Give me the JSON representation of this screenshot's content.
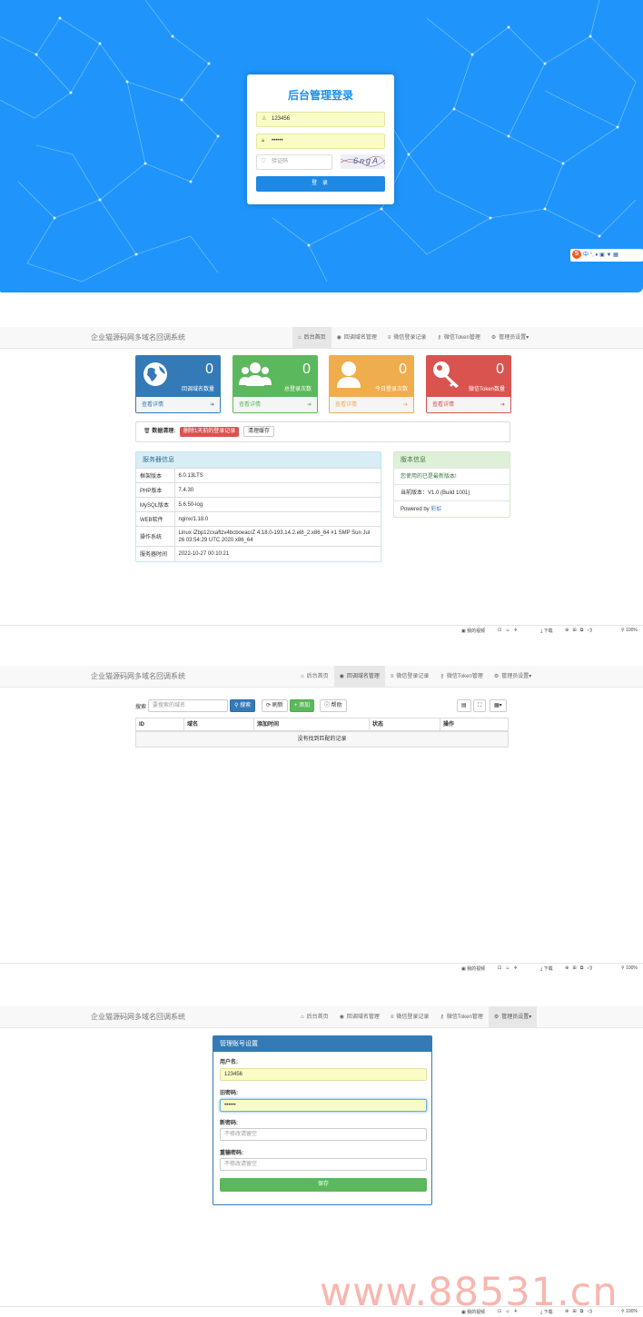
{
  "login": {
    "title": "后台管理登录",
    "username": "123456",
    "password": "••••••",
    "captcha_placeholder": "验证码",
    "captcha_text": "6ngA",
    "submit": "登 录",
    "toolbar": "中 °, ♦ ▣ ▼ ▦"
  },
  "brand": "企业猫源码网多域名回调系统",
  "nav": [
    {
      "label": "后台首页",
      "icon": "home-icon",
      "glyph": "⌂"
    },
    {
      "label": "回调域名管理",
      "icon": "globe-icon",
      "glyph": "◉"
    },
    {
      "label": "微信登录记录",
      "icon": "list-icon",
      "glyph": "≡"
    },
    {
      "label": "微信Token管理",
      "icon": "key-icon",
      "glyph": "⚷"
    },
    {
      "label": "管理员设置▾",
      "icon": "gear-icon",
      "glyph": "⚙"
    }
  ],
  "stats": [
    {
      "value": "0",
      "label": "回调域名数量",
      "link": "查看详情",
      "color": "#337ab7",
      "icon": "globe-icon"
    },
    {
      "value": "0",
      "label": "总登录次数",
      "link": "查看详情",
      "color": "#5cb85c",
      "icon": "users-icon"
    },
    {
      "value": "0",
      "label": "今日登录次数",
      "link": "查看详情",
      "color": "#f0ad4e",
      "icon": "user-icon"
    },
    {
      "value": "0",
      "label": "微信Token数量",
      "link": "查看详情",
      "color": "#d9534f",
      "icon": "key-icon"
    }
  ],
  "cleanup": {
    "label": "数据清理:",
    "delete_btn": "删除1天前的登录记录",
    "cache_btn": "清理缓存"
  },
  "server": {
    "title": "服务器信息",
    "rows": [
      {
        "k": "框架版本",
        "v": "6.0.13LTS"
      },
      {
        "k": "PHP版本",
        "v": "7.4.30"
      },
      {
        "k": "MySQL版本",
        "v": "5.6.50-log"
      },
      {
        "k": "WEB软件",
        "v": "nginx/1.18.0"
      },
      {
        "k": "操作系统",
        "v": "Linux iZbp12cxaftzv4bcboeacrZ 4.18.0-193.14.2.el8_2.x86_64 #1 SMP Sun Jul 26 03:54:29 UTC 2020 x86_64"
      },
      {
        "k": "服务器时间",
        "v": "2022-10-27 00:10:21"
      }
    ]
  },
  "version": {
    "title": "版本信息",
    "latest": "您使用的已是最新版本!",
    "current": "当前版本：V1.0 (Build 1001)",
    "powered": "Powered by ",
    "powered_link": "彩虹"
  },
  "bottombar": {
    "video": "我的视频",
    "download": "下载",
    "zoom": "100%"
  },
  "domains": {
    "search_label": "搜索",
    "search_placeholder": "要搜索的域名",
    "search_btn": "搜索",
    "refresh_btn": "刷新",
    "add_btn": "添加",
    "help_btn": "帮助",
    "columns": [
      "ID",
      "域名",
      "添加时间",
      "状态",
      "操作"
    ],
    "empty": "没有找到匹配的记录"
  },
  "settings": {
    "title": "管理账号设置",
    "username_label": "用户名:",
    "username": "123456",
    "old_label": "旧密码:",
    "old_value": "••••••",
    "new_label": "新密码:",
    "new_placeholder": "不修改请留空",
    "repeat_label": "重输密码:",
    "repeat_placeholder": "不修改请留空",
    "save_btn": "保存"
  },
  "watermark": "www.88531.cn"
}
